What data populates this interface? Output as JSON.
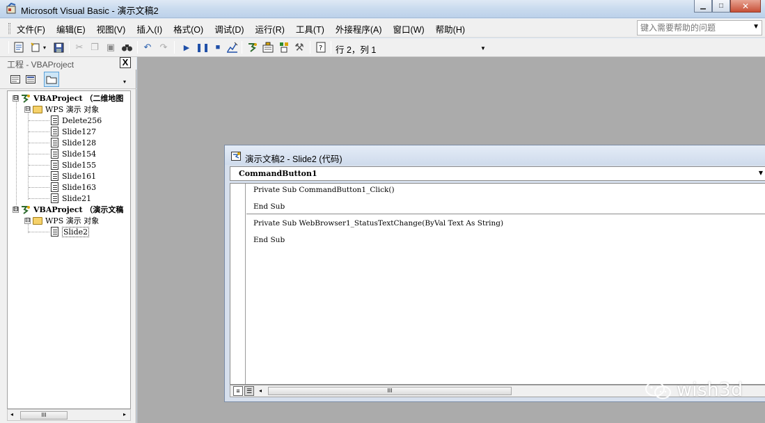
{
  "window": {
    "title": "Microsoft Visual Basic - 演示文稿2",
    "minimize_glyph": "▁",
    "maximize_glyph": "□",
    "close_glyph": "✕"
  },
  "menubar": {
    "items": [
      "文件(F)",
      "编辑(E)",
      "视图(V)",
      "插入(I)",
      "格式(O)",
      "调试(D)",
      "运行(R)",
      "工具(T)",
      "外接程序(A)",
      "窗口(W)",
      "帮助(H)"
    ],
    "help_search": {
      "placeholder": "键入需要帮助的问题",
      "value": ""
    }
  },
  "toolbar": {
    "icons": [
      "view-excel-icon",
      "insert-module-icon",
      "save-icon",
      "cut-icon",
      "copy-icon",
      "paste-icon",
      "find-icon",
      "undo-icon",
      "redo-icon",
      "run-icon",
      "break-icon",
      "reset-icon",
      "design-mode-icon",
      "project-explorer-icon",
      "properties-icon",
      "object-browser-icon",
      "toolbox-icon",
      "help-icon"
    ],
    "cursor_position": "行 2，列 1"
  },
  "project_explorer": {
    "title": "工程 - VBAProject",
    "close_glyph": "X",
    "tree": [
      {
        "label": "VBAProject （二维地图",
        "level": 0,
        "type": "project",
        "expander": "⊟"
      },
      {
        "label": "WPS 演示 对象",
        "level": 1,
        "type": "folder",
        "expander": "⊟"
      },
      {
        "label": "Delete256",
        "level": 2,
        "type": "slide"
      },
      {
        "label": "Slide127",
        "level": 2,
        "type": "slide"
      },
      {
        "label": "Slide128",
        "level": 2,
        "type": "slide"
      },
      {
        "label": "Slide154",
        "level": 2,
        "type": "slide"
      },
      {
        "label": "Slide155",
        "level": 2,
        "type": "slide"
      },
      {
        "label": "Slide161",
        "level": 2,
        "type": "slide"
      },
      {
        "label": "Slide163",
        "level": 2,
        "type": "slide"
      },
      {
        "label": "Slide21",
        "level": 2,
        "type": "slide"
      },
      {
        "label": "VBAProject （演示文稿",
        "level": 0,
        "type": "project",
        "expander": "⊟"
      },
      {
        "label": "WPS 演示 对象",
        "level": 1,
        "type": "folder",
        "expander": "⊟"
      },
      {
        "label": "Slide2",
        "level": 2,
        "type": "slide",
        "selected": true
      }
    ],
    "scroll_thumb_glyph": "III"
  },
  "code_window": {
    "title": "演示文稿2 - Slide2 (代码)",
    "object_dropdown": "CommandButton1",
    "lines": [
      "Private Sub CommandButton1_Click()",
      "End Sub",
      "Private Sub WebBrowser1_StatusTextChange(ByVal Text As String)",
      "End Sub"
    ],
    "scroll_thumb_glyph": "III"
  },
  "watermark": {
    "text": "wish3d"
  },
  "colors": {
    "mdi_background": "#ababab",
    "titlebar": "#c9dbee",
    "close_button": "#c75037"
  }
}
